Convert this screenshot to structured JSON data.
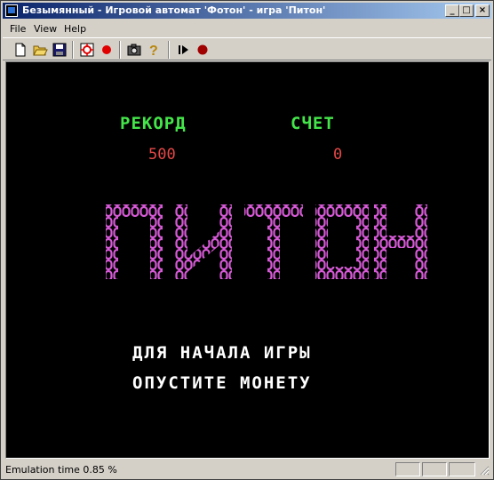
{
  "window": {
    "title": "Безымянный - Игровой автомат 'Фотон' - игра 'Питон'",
    "minimize": "_",
    "maximize": "□",
    "close": "×"
  },
  "menu": {
    "file": "File",
    "view": "View",
    "help": "Help"
  },
  "toolbar": {
    "icons": [
      "new-file-icon",
      "open-folder-icon",
      "save-icon",
      "target-icon",
      "record-icon",
      "camera-icon",
      "help-icon",
      "play-icon",
      "stop-record-icon"
    ]
  },
  "game": {
    "record_label": "РЕКОРД",
    "score_label": "СЧЕТ",
    "record_value": "500",
    "score_value": "0",
    "title": "ПИТОН",
    "line1": "ДЛЯ НАЧАЛА ИГРЫ",
    "line2": "ОПУСТИТЕ МОНЕТУ",
    "colors": {
      "label": "#44e54a",
      "value": "#e64848",
      "title": "#d65ad6",
      "text": "#ffffff"
    }
  },
  "status": {
    "text": "Emulation time  0.85 %"
  }
}
